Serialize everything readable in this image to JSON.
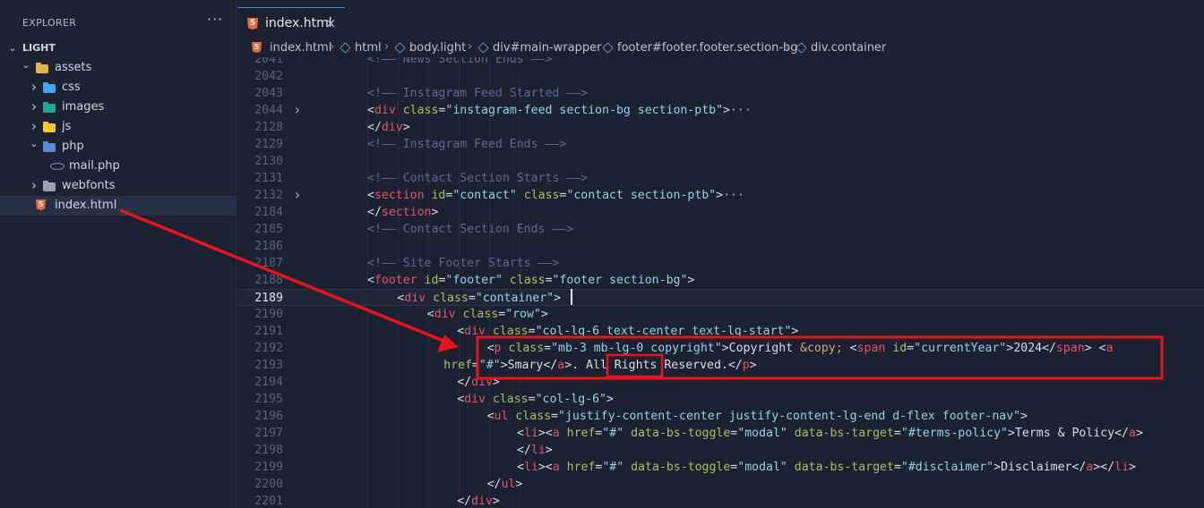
{
  "explorer": {
    "title": "EXPLORER",
    "more": "···",
    "root": "LIGHT",
    "items": [
      {
        "label": "assets",
        "kind": "folder-open"
      },
      {
        "label": "css",
        "kind": "folder",
        "icon_color": "#42a5f5"
      },
      {
        "label": "images",
        "kind": "folder",
        "icon_color": "#26a69a"
      },
      {
        "label": "js",
        "kind": "folder",
        "icon_color": "#ffca28"
      },
      {
        "label": "php",
        "kind": "folder-open",
        "icon_color": "#5b8bd6"
      },
      {
        "label": "mail.php",
        "kind": "file",
        "icon_color": "#6c8ed8"
      },
      {
        "label": "webfonts",
        "kind": "folder",
        "icon_color": "#9aa3b2"
      },
      {
        "label": "index.html",
        "kind": "file",
        "icon_color": "#e8693a"
      }
    ]
  },
  "tab": {
    "label": "index.html",
    "close": "×",
    "icon": "html5-icon"
  },
  "breadcrumb": [
    "index.html",
    "html",
    "body.light",
    "div#main-wrapper",
    "footer#footer.footer.section-bg",
    "div.container"
  ],
  "editor": {
    "current_line": "2189",
    "lines": [
      {
        "n": "2041",
        "segs": [
          [
            "com",
            "<!—— News Section Ends ——>"
          ]
        ],
        "indent": 2
      },
      {
        "n": "2042",
        "segs": [],
        "indent": 0
      },
      {
        "n": "2043",
        "segs": [
          [
            "com",
            "<!—— Instagram Feed Started ——>"
          ]
        ],
        "indent": 2
      },
      {
        "n": "2044",
        "fold": true,
        "segs": [
          [
            "pun",
            "<"
          ],
          [
            "tag",
            "div"
          ],
          [
            "pun",
            " "
          ],
          [
            "attr",
            "class"
          ],
          [
            "pun",
            "="
          ],
          [
            "str",
            "\"instagram-feed section-bg section-ptb\""
          ],
          [
            "pun",
            ">"
          ],
          [
            "ell",
            "···"
          ]
        ],
        "indent": 2
      },
      {
        "n": "2128",
        "segs": [
          [
            "pun",
            "</"
          ],
          [
            "tag",
            "div"
          ],
          [
            "pun",
            ">"
          ]
        ],
        "indent": 2
      },
      {
        "n": "2129",
        "segs": [
          [
            "com",
            "<!—— Instagram Feed Ends ——>"
          ]
        ],
        "indent": 2
      },
      {
        "n": "2130",
        "segs": [],
        "indent": 0
      },
      {
        "n": "2131",
        "segs": [
          [
            "com",
            "<!—— Contact Section Starts ——>"
          ]
        ],
        "indent": 2
      },
      {
        "n": "2132",
        "fold": true,
        "segs": [
          [
            "pun",
            "<"
          ],
          [
            "tag",
            "section"
          ],
          [
            "pun",
            " "
          ],
          [
            "attr",
            "id"
          ],
          [
            "pun",
            "="
          ],
          [
            "str",
            "\"contact\""
          ],
          [
            "pun",
            " "
          ],
          [
            "attr",
            "class"
          ],
          [
            "pun",
            "="
          ],
          [
            "str",
            "\"contact section-ptb\""
          ],
          [
            "pun",
            ">"
          ],
          [
            "ell",
            "···"
          ]
        ],
        "indent": 2
      },
      {
        "n": "2184",
        "segs": [
          [
            "pun",
            "</"
          ],
          [
            "tag",
            "section"
          ],
          [
            "pun",
            ">"
          ]
        ],
        "indent": 2
      },
      {
        "n": "2185",
        "segs": [
          [
            "com",
            "<!—— Contact Section Ends ——>"
          ]
        ],
        "indent": 2
      },
      {
        "n": "2186",
        "segs": [],
        "indent": 0
      },
      {
        "n": "2187",
        "segs": [
          [
            "com",
            "<!—— Site Footer Starts ——>"
          ]
        ],
        "indent": 2
      },
      {
        "n": "2188",
        "segs": [
          [
            "pun",
            "<"
          ],
          [
            "tag",
            "footer"
          ],
          [
            "pun",
            " "
          ],
          [
            "attr",
            "id"
          ],
          [
            "pun",
            "="
          ],
          [
            "str",
            "\"footer\""
          ],
          [
            "pun",
            " "
          ],
          [
            "attr",
            "class"
          ],
          [
            "pun",
            "="
          ],
          [
            "str",
            "\"footer section-bg\""
          ],
          [
            "pun",
            ">"
          ]
        ],
        "indent": 2
      },
      {
        "n": "2189",
        "segs": [
          [
            "pun",
            "<"
          ],
          [
            "tag",
            "div"
          ],
          [
            "pun",
            " "
          ],
          [
            "attr",
            "class"
          ],
          [
            "pun",
            "="
          ],
          [
            "str",
            "\"container\""
          ],
          [
            "pun",
            ">"
          ]
        ],
        "indent": 3
      },
      {
        "n": "2190",
        "segs": [
          [
            "pun",
            "<"
          ],
          [
            "tag",
            "div"
          ],
          [
            "pun",
            " "
          ],
          [
            "attr",
            "class"
          ],
          [
            "pun",
            "="
          ],
          [
            "str",
            "\"row\""
          ],
          [
            "pun",
            ">"
          ]
        ],
        "indent": 4
      },
      {
        "n": "2191",
        "segs": [
          [
            "pun",
            "<"
          ],
          [
            "tag",
            "div"
          ],
          [
            "pun",
            " "
          ],
          [
            "attr",
            "class"
          ],
          [
            "pun",
            "="
          ],
          [
            "str",
            "\"col-lg-6 text-center text-lg-start\""
          ],
          [
            "pun",
            ">"
          ]
        ],
        "indent": 5
      },
      {
        "n": "2192",
        "segs": [
          [
            "pun",
            "<"
          ],
          [
            "tag",
            "p"
          ],
          [
            "pun",
            " "
          ],
          [
            "attr",
            "class"
          ],
          [
            "pun",
            "="
          ],
          [
            "str",
            "\"mb-3 mb-lg-0 copyright\""
          ],
          [
            "pun",
            ">"
          ],
          [
            "txt",
            "Copyright "
          ],
          [
            "ent",
            "&copy;"
          ],
          [
            "txt",
            " "
          ],
          [
            "pun",
            "<"
          ],
          [
            "tag",
            "span"
          ],
          [
            "pun",
            " "
          ],
          [
            "attr",
            "id"
          ],
          [
            "pun",
            "="
          ],
          [
            "str",
            "\"currentYear\""
          ],
          [
            "pun",
            ">"
          ],
          [
            "txt",
            "2024"
          ],
          [
            "pun",
            "</"
          ],
          [
            "tag",
            "span"
          ],
          [
            "pun",
            ">"
          ],
          [
            "txt",
            " "
          ],
          [
            "pun",
            "<"
          ],
          [
            "tag",
            "a"
          ]
        ],
        "indent": 6
      },
      {
        "n": "2193",
        "segs": [
          [
            "attr",
            "href"
          ],
          [
            "pun",
            "="
          ],
          [
            "str",
            "\"#\""
          ],
          [
            "pun",
            ">"
          ],
          [
            "txt",
            "Smary"
          ],
          [
            "pun",
            "</"
          ],
          [
            "tag",
            "a"
          ],
          [
            "pun",
            ">"
          ],
          [
            "txt",
            ". All Rights Reserved."
          ],
          [
            "pun",
            "</"
          ],
          [
            "tag",
            "p"
          ],
          [
            "pun",
            ">"
          ]
        ],
        "indent": 6,
        "wrap": true
      },
      {
        "n": "2194",
        "segs": [
          [
            "pun",
            "</"
          ],
          [
            "tag",
            "div"
          ],
          [
            "pun",
            ">"
          ]
        ],
        "indent": 5
      },
      {
        "n": "2195",
        "segs": [
          [
            "pun",
            "<"
          ],
          [
            "tag",
            "div"
          ],
          [
            "pun",
            " "
          ],
          [
            "attr",
            "class"
          ],
          [
            "pun",
            "="
          ],
          [
            "str",
            "\"col-lg-6\""
          ],
          [
            "pun",
            ">"
          ]
        ],
        "indent": 5
      },
      {
        "n": "2196",
        "segs": [
          [
            "pun",
            "<"
          ],
          [
            "tag",
            "ul"
          ],
          [
            "pun",
            " "
          ],
          [
            "attr",
            "class"
          ],
          [
            "pun",
            "="
          ],
          [
            "str",
            "\"justify-content-center justify-content-lg-end d-flex footer-nav\""
          ],
          [
            "pun",
            ">"
          ]
        ],
        "indent": 6
      },
      {
        "n": "2197",
        "segs": [
          [
            "pun",
            "<"
          ],
          [
            "tag",
            "li"
          ],
          [
            "pun",
            "><"
          ],
          [
            "tag",
            "a"
          ],
          [
            "pun",
            " "
          ],
          [
            "attr",
            "href"
          ],
          [
            "pun",
            "="
          ],
          [
            "str",
            "\"#\""
          ],
          [
            "pun",
            " "
          ],
          [
            "attr",
            "data-bs-toggle"
          ],
          [
            "pun",
            "="
          ],
          [
            "str",
            "\"modal\""
          ],
          [
            "pun",
            " "
          ],
          [
            "attr",
            "data-bs-target"
          ],
          [
            "pun",
            "="
          ],
          [
            "str",
            "\"#terms-policy\""
          ],
          [
            "pun",
            ">"
          ],
          [
            "txt",
            "Terms & Policy"
          ],
          [
            "pun",
            "</"
          ],
          [
            "tag",
            "a"
          ],
          [
            "pun",
            ">"
          ]
        ],
        "indent": 7
      },
      {
        "n": "2198",
        "segs": [
          [
            "pun",
            "</"
          ],
          [
            "tag",
            "li"
          ],
          [
            "pun",
            ">"
          ]
        ],
        "indent": 7
      },
      {
        "n": "2199",
        "segs": [
          [
            "pun",
            "<"
          ],
          [
            "tag",
            "li"
          ],
          [
            "pun",
            "><"
          ],
          [
            "tag",
            "a"
          ],
          [
            "pun",
            " "
          ],
          [
            "attr",
            "href"
          ],
          [
            "pun",
            "="
          ],
          [
            "str",
            "\"#\""
          ],
          [
            "pun",
            " "
          ],
          [
            "attr",
            "data-bs-toggle"
          ],
          [
            "pun",
            "="
          ],
          [
            "str",
            "\"modal\""
          ],
          [
            "pun",
            " "
          ],
          [
            "attr",
            "data-bs-target"
          ],
          [
            "pun",
            "="
          ],
          [
            "str",
            "\"#disclaimer\""
          ],
          [
            "pun",
            ">"
          ],
          [
            "txt",
            "Disclaimer"
          ],
          [
            "pun",
            "</"
          ],
          [
            "tag",
            "a"
          ],
          [
            "pun",
            "></"
          ],
          [
            "tag",
            "li"
          ],
          [
            "pun",
            ">"
          ]
        ],
        "indent": 7
      },
      {
        "n": "2200",
        "segs": [
          [
            "pun",
            "</"
          ],
          [
            "tag",
            "ul"
          ],
          [
            "pun",
            ">"
          ]
        ],
        "indent": 6
      },
      {
        "n": "2201",
        "segs": [
          [
            "pun",
            "</"
          ],
          [
            "tag",
            "div"
          ],
          [
            "pun",
            ">"
          ]
        ],
        "indent": 5
      }
    ]
  },
  "colors": {
    "annotation": "#e8141b",
    "accent": "#3a8ee6"
  }
}
